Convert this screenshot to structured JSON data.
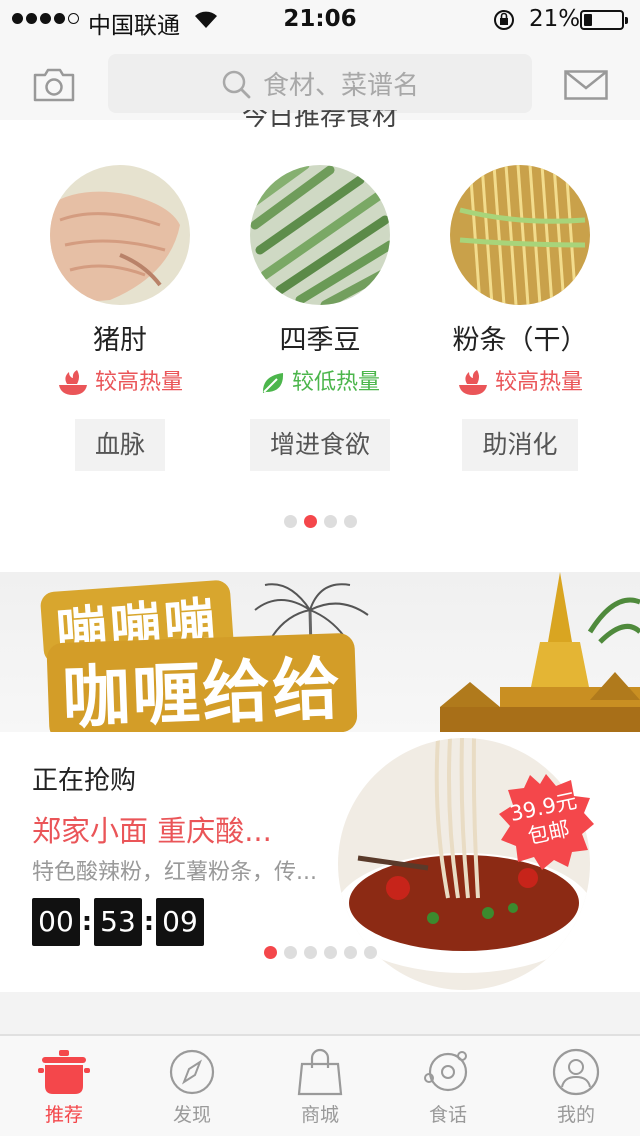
{
  "status": {
    "carrier": "中国联通",
    "time": "21:06",
    "battery": "21%",
    "battery_level": 0.21
  },
  "header": {
    "search_placeholder": "食材、菜谱名",
    "section_title": "今日推荐食材"
  },
  "foods": [
    {
      "name": "猪肘",
      "calorie": "较高热量",
      "calorie_level": "high",
      "tag": "血脉"
    },
    {
      "name": "四季豆",
      "calorie": "较低热量",
      "calorie_level": "low",
      "tag": "增进食欲"
    },
    {
      "name": "粉条（干）",
      "calorie": "较高热量",
      "calorie_level": "high",
      "tag": "助消化"
    }
  ],
  "foods_pager": {
    "count": 4,
    "active": 1
  },
  "banner": {
    "line1": "嘣嘣嘣",
    "line2": "咖喱给给"
  },
  "flash_sale": {
    "label": "正在抢购",
    "title": "郑家小面 重庆酸...",
    "description": "特色酸辣粉，红薯粉条，传...",
    "timer": {
      "hours": "00",
      "minutes": "53",
      "seconds": "09"
    },
    "price_line1": "39.9元",
    "price_line2": "包邮",
    "pager": {
      "count": 6,
      "active": 0
    }
  },
  "tabs": [
    {
      "label": "推荐",
      "icon": "pot-icon",
      "active": true
    },
    {
      "label": "发现",
      "icon": "compass-icon",
      "active": false
    },
    {
      "label": "商城",
      "icon": "shopping-bag-icon",
      "active": false
    },
    {
      "label": "食话",
      "icon": "planet-icon",
      "active": false
    },
    {
      "label": "我的",
      "icon": "user-icon",
      "active": false
    }
  ],
  "colors": {
    "accent": "#f4474b",
    "high_calorie": "#ea5558",
    "low_calorie": "#4cb64c"
  }
}
